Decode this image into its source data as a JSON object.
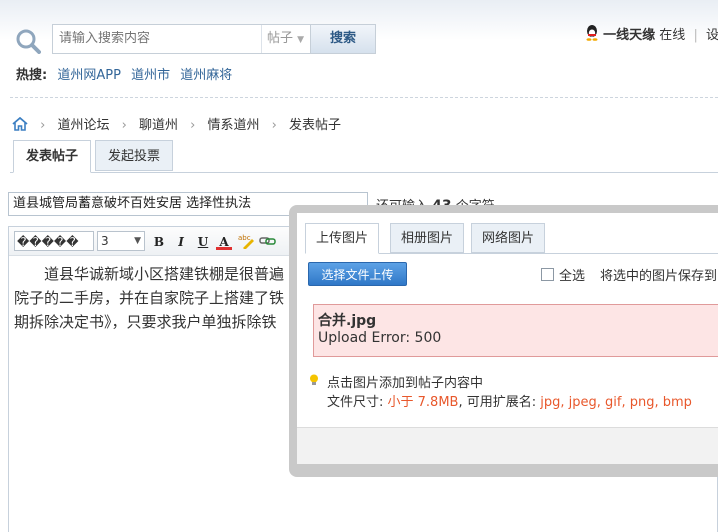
{
  "search": {
    "placeholder": "请输入搜索内容",
    "scope": "帖子",
    "button": "搜索"
  },
  "hot": {
    "label": "热搜:",
    "links": [
      "道州网APP",
      "道州市",
      "道州麻将"
    ]
  },
  "user": {
    "name": "一线天缘",
    "status": "在线",
    "more": "设"
  },
  "breadcrumb": [
    "道州论坛",
    "聊道州",
    "情系道州",
    "发表帖子"
  ],
  "tabs": [
    "发表帖子",
    "发起投票"
  ],
  "post": {
    "title": "道县城管局蓄意破坏百姓安居 选择性执法",
    "remain_prefix": "还可输入",
    "remain_count": "43",
    "remain_suffix": "个字符"
  },
  "toolbar": {
    "font": "�����",
    "size": "3",
    "bold": "B",
    "italic": "I",
    "underline": "U",
    "color": "A"
  },
  "content": [
    "　　道县华诚新域小区搭建铁棚是很普遍",
    "院子的二手房，并在自家院子上搭建了铁",
    "期拆除决定书》，只要求我户单独拆除铁"
  ],
  "upload_dialog": {
    "tabs": [
      "上传图片",
      "相册图片",
      "网络图片"
    ],
    "upload_button": "选择文件上传",
    "select_all": "全选",
    "save_label": "将选中的图片保存到",
    "error_file": "合并.jpg",
    "error_msg": "Upload Error: 500",
    "tip": "点击图片添加到帖子内容中",
    "size_prefix": "文件尺寸: ",
    "size_limit": "小于 7.8MB",
    "ext_prefix": ", 可用扩展名: ",
    "extensions": "jpg, jpeg, gif, png, bmp"
  }
}
